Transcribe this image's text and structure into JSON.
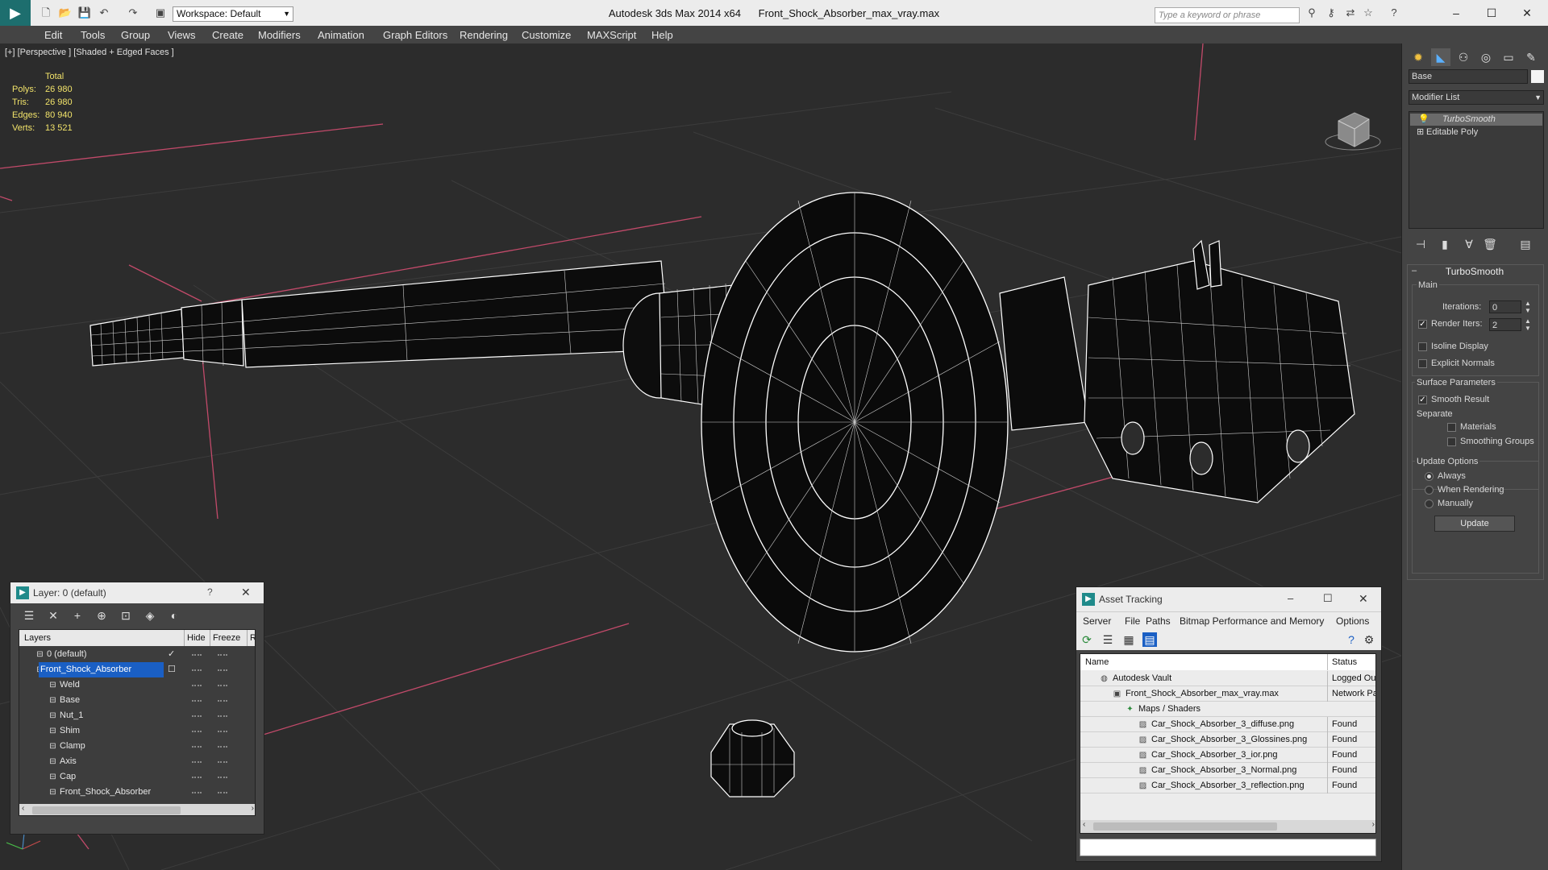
{
  "app": {
    "title_left": "Autodesk 3ds Max  2014 x64",
    "title_file": "Front_Shock_Absorber_max_vray.max",
    "workspace": "Workspace: Default",
    "search_placeholder": "Type a keyword or phrase"
  },
  "menu": [
    "Edit",
    "Tools",
    "Group",
    "Views",
    "Create",
    "Modifiers",
    "Animation",
    "Graph Editors",
    "Rendering",
    "Customize",
    "MAXScript",
    "Help"
  ],
  "viewport": {
    "label": "[+] [Perspective ] [Shaded + Edged Faces ]",
    "stats": {
      "header": "Total",
      "rows": [
        {
          "label": "Polys:",
          "value": "26 980"
        },
        {
          "label": "Tris:",
          "value": "26 980"
        },
        {
          "label": "Edges:",
          "value": "80 940"
        },
        {
          "label": "Verts:",
          "value": "13 521"
        }
      ]
    }
  },
  "command_panel": {
    "object_name": "Base",
    "modifier_list": "Modifier List",
    "stack": [
      "TurboSmooth",
      "Editable Poly"
    ],
    "rollout": "TurboSmooth",
    "main_group": "Main",
    "iterations_label": "Iterations:",
    "iterations_value": "0",
    "render_iters_label": "Render Iters:",
    "render_iters_value": "2",
    "isoline": "Isoline Display",
    "explicit_normals": "Explicit Normals",
    "surface_group": "Surface Parameters",
    "smooth_result": "Smooth Result",
    "separate": "Separate",
    "materials": "Materials",
    "smoothing_groups": "Smoothing Groups",
    "update_group": "Update Options",
    "always": "Always",
    "when_rendering": "When Rendering",
    "manually": "Manually",
    "update_btn": "Update"
  },
  "layer_dialog": {
    "title": "Layer: 0 (default)",
    "help": "?",
    "col_layers": "Layers",
    "col_hide": "Hide",
    "col_freeze": "Freeze",
    "col_r": "R",
    "rows": [
      {
        "name": "0 (default)",
        "indent": 1,
        "selected": false
      },
      {
        "name": "Front_Shock_Absorber",
        "indent": 1,
        "selected": true
      },
      {
        "name": "Weld",
        "indent": 2,
        "selected": false
      },
      {
        "name": "Base",
        "indent": 2,
        "selected": false
      },
      {
        "name": "Nut_1",
        "indent": 2,
        "selected": false
      },
      {
        "name": "Shim",
        "indent": 2,
        "selected": false
      },
      {
        "name": "Clamp",
        "indent": 2,
        "selected": false
      },
      {
        "name": "Axis",
        "indent": 2,
        "selected": false
      },
      {
        "name": "Cap",
        "indent": 2,
        "selected": false
      },
      {
        "name": "Front_Shock_Absorber",
        "indent": 2,
        "selected": false
      }
    ]
  },
  "asset_dialog": {
    "title": "Asset Tracking",
    "menu": [
      "Server",
      "File",
      "Paths",
      "Bitmap Performance and Memory",
      "Options"
    ],
    "col_name": "Name",
    "col_status": "Status",
    "rows": [
      {
        "name": "Autodesk Vault",
        "status": "Logged Ou",
        "indent": 1
      },
      {
        "name": "Front_Shock_Absorber_max_vray.max",
        "status": "Network Pa",
        "indent": 2
      },
      {
        "name": "Maps / Shaders",
        "status": "",
        "indent": 3
      },
      {
        "name": "Car_Shock_Absorber_3_diffuse.png",
        "status": "Found",
        "indent": 4
      },
      {
        "name": "Car_Shock_Absorber_3_Glossines.png",
        "status": "Found",
        "indent": 4
      },
      {
        "name": "Car_Shock_Absorber_3_ior.png",
        "status": "Found",
        "indent": 4
      },
      {
        "name": "Car_Shock_Absorber_3_Normal.png",
        "status": "Found",
        "indent": 4
      },
      {
        "name": "Car_Shock_Absorber_3_reflection.png",
        "status": "Found",
        "indent": 4
      }
    ]
  },
  "colors": {
    "accent": "#1a5fc4",
    "stats": "#f2e36a",
    "grid": "#3a3a3a",
    "wire": "#ffffff",
    "red_lines": "#c24a6a"
  }
}
